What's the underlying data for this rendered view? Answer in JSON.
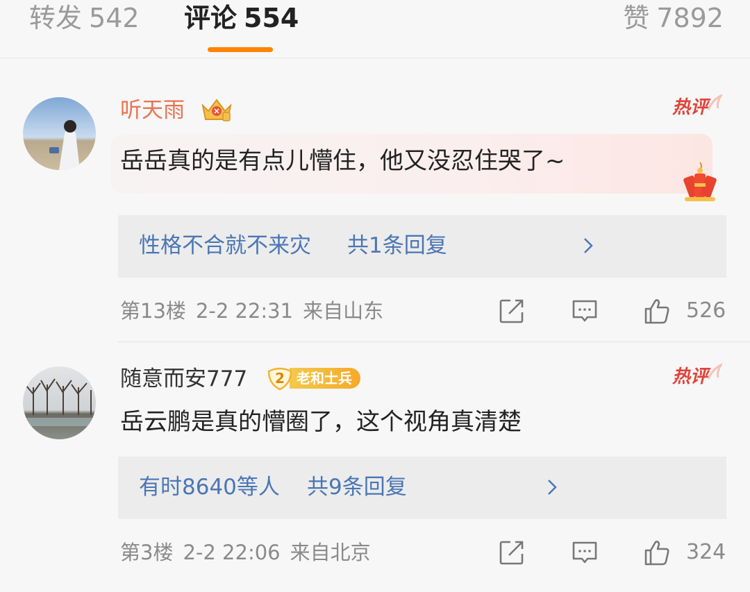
{
  "tabs": {
    "reposts": {
      "label": "转发",
      "count": "542"
    },
    "comments": {
      "label": "评论",
      "count": "554"
    },
    "likes": {
      "label": "赞",
      "count": "7892"
    },
    "active": "comments",
    "accent_color": "#ff8200"
  },
  "comments": [
    {
      "username": "听天雨",
      "username_color": "#eb7350",
      "badge_icon": "vip-crown-badge",
      "hot_tag": "热评",
      "content": "岳岳真的是有点儿懵住，他又没忍住哭了~",
      "decoration_icon": "firecracker-icon",
      "reply_users": "性格不合就不来灾",
      "reply_count": "共1条回复",
      "floor": "第13楼",
      "time": "2-2 22:31",
      "location": "来自山东",
      "likes": "526"
    },
    {
      "username": "随意而安777",
      "username_color": "#333333",
      "badge_level": "2",
      "badge_label": "老和士兵",
      "hot_tag": "热评",
      "content": "岳云鹏是真的懵圈了，这个视角真清楚",
      "reply_users": "有时8640等人",
      "reply_count": "共9条回复",
      "floor": "第3楼",
      "time": "2-2 22:06",
      "location": "来自北京",
      "likes": "324"
    }
  ],
  "link_color": "#4a76b4",
  "hot_color": "#e0433a"
}
